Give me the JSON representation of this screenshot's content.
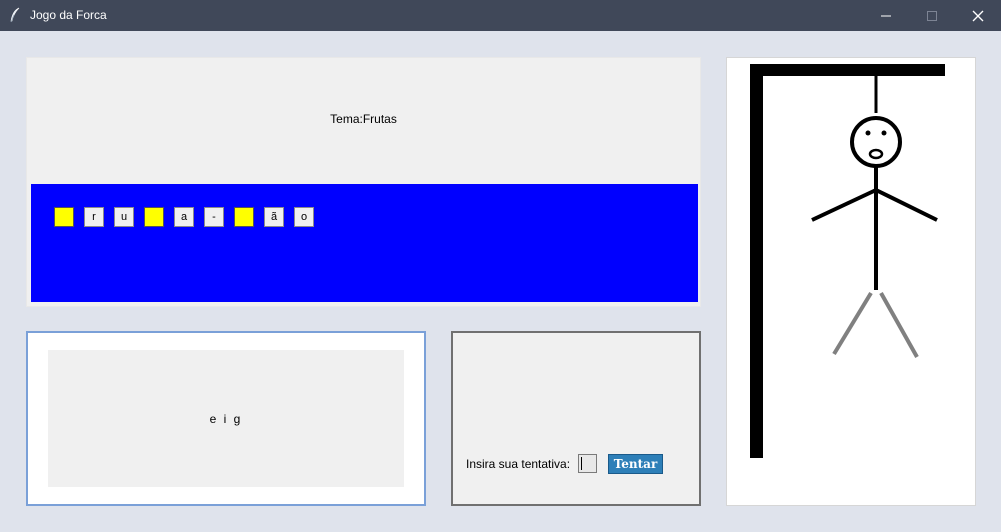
{
  "window": {
    "title": "Jogo da Forca",
    "icon": "feather-icon",
    "controls": [
      "minimize-icon",
      "maximize-icon",
      "close-icon"
    ]
  },
  "theme": {
    "label": "Tema:Frutas"
  },
  "word": {
    "background": "#0000ff",
    "hidden_color": "#ffff00",
    "letters": [
      {
        "char": "",
        "revealed": false
      },
      {
        "char": "r",
        "revealed": true
      },
      {
        "char": "u",
        "revealed": true
      },
      {
        "char": "",
        "revealed": false
      },
      {
        "char": "a",
        "revealed": true
      },
      {
        "char": "-",
        "revealed": true
      },
      {
        "char": "",
        "revealed": false
      },
      {
        "char": "ã",
        "revealed": true
      },
      {
        "char": "o",
        "revealed": true
      }
    ]
  },
  "used_letters": {
    "text": "e i g"
  },
  "guess": {
    "label": "Insira sua tentativa:",
    "value": "",
    "button_label": "Tentar",
    "button_color": "#2d7fb8"
  },
  "hangman": {
    "drawn_parts": [
      "head",
      "face",
      "body",
      "left-arm",
      "right-arm",
      "left-leg",
      "right-leg"
    ],
    "leg_color": "#808080"
  }
}
